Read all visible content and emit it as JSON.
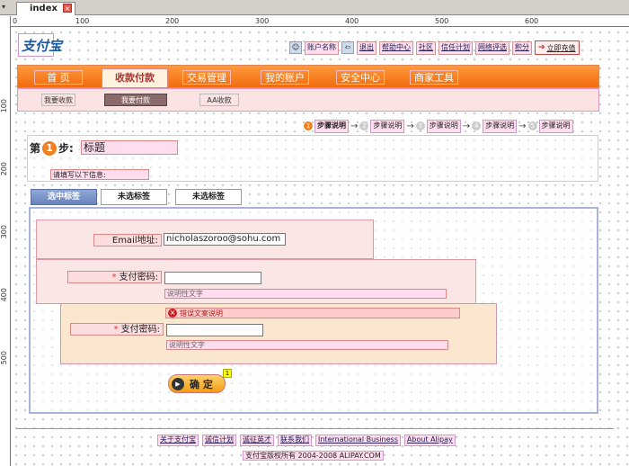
{
  "editor": {
    "tab_title": "index",
    "ruler_top": [
      "0",
      "100",
      "200",
      "300",
      "400",
      "500",
      "600"
    ],
    "ruler_left": [
      "100",
      "200",
      "300",
      "400",
      "500"
    ]
  },
  "header": {
    "logo_text": "支付宝",
    "account_label": "账户名称",
    "links": [
      "退出",
      "帮助中心",
      "社区",
      "信任计划",
      "网络评选",
      "积分"
    ],
    "exit_button": "立即充值"
  },
  "nav": {
    "items": [
      "首 页",
      "收款付款",
      "交易管理",
      "我的账户",
      "安全中心",
      "商家工具"
    ],
    "active_index": 1
  },
  "subnav": {
    "items": [
      "我要收款",
      "我要付款",
      "AA收款"
    ],
    "active_index": 1
  },
  "steps": {
    "items": [
      {
        "num": "1",
        "label": "步骤说明"
      },
      {
        "num": "2",
        "label": "步骤说明"
      },
      {
        "num": "3",
        "label": "步骤说明"
      },
      {
        "num": "4",
        "label": "步骤说明"
      },
      {
        "num": "5",
        "label": "步骤说明"
      }
    ]
  },
  "title_block": {
    "prefix": "第",
    "step_number": "1",
    "suffix": "步:",
    "title": "标题",
    "hint": "请填写以下信息:"
  },
  "tabs": [
    "选中标签",
    "未选标签",
    "未选标签"
  ],
  "form": {
    "email_label": "Email地址:",
    "email_value": "nicholaszoroo@sohu.com",
    "pwd1_label": "支付密码:",
    "pwd1_hint": "说明性文字",
    "error_text": "错误文案说明",
    "pwd2_label": "支付密码:",
    "pwd2_hint": "说明性文字",
    "required_mark": "*",
    "submit_label": "确 定",
    "submit_badge": "1"
  },
  "footer": {
    "links": [
      "关于支付宝",
      "诚信计划",
      "诚征英才",
      "联系我们",
      "International Business",
      "About Alipay"
    ],
    "copyright": "支付宝版权所有 2004-2008 ALIPAY.COM"
  },
  "colors": {
    "nav_orange": "#f26b0f",
    "tab_selected": "#6a84bc",
    "error_red": "#c22"
  }
}
